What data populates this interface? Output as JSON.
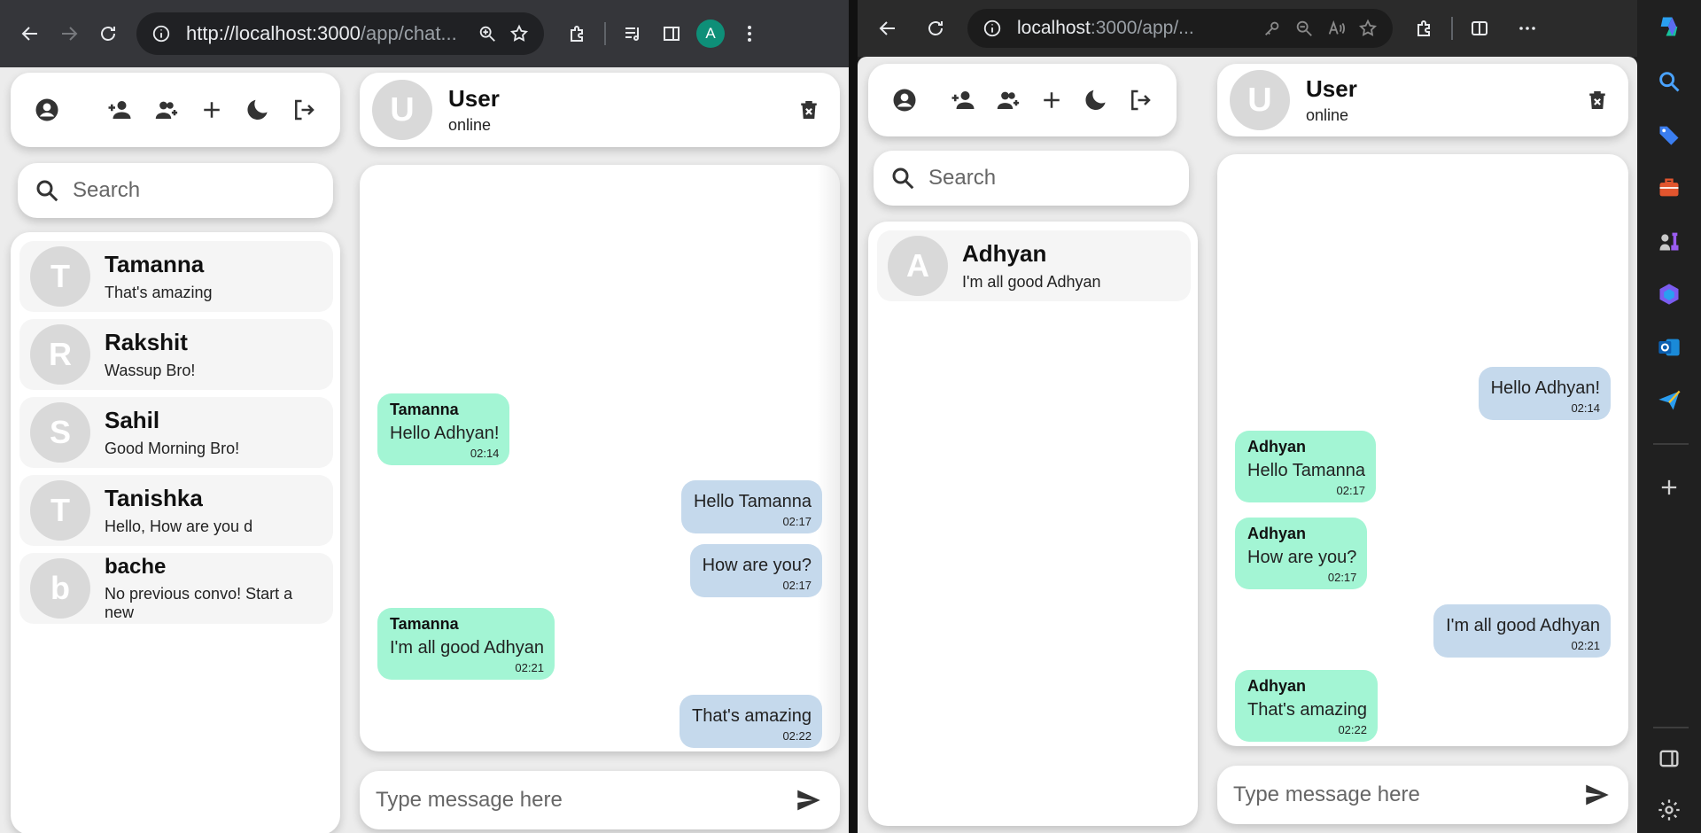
{
  "left_browser": {
    "url_host": "http://localhost:3000",
    "url_path": "/app/chat...",
    "avatar_letter": "A"
  },
  "right_browser": {
    "url_host": "localhost",
    "url_path": ":3000/app/..."
  },
  "app": {
    "search_placeholder": "Search",
    "composer_placeholder": "Type message here",
    "chat_header": {
      "avatar_letter": "U",
      "name": "User",
      "status": "online"
    }
  },
  "left_app": {
    "contacts": [
      {
        "letter": "T",
        "name": "Tamanna",
        "last_message": "That's amazing"
      },
      {
        "letter": "R",
        "name": "Rakshit",
        "last_message": "Wassup Bro!"
      },
      {
        "letter": "S",
        "name": "Sahil",
        "last_message": "Good Morning Bro!"
      },
      {
        "letter": "T",
        "name": "Tanishka",
        "last_message": "Hello, How are you d"
      },
      {
        "letter": "b",
        "name": "bache",
        "last_message": "No previous convo! Start a new"
      }
    ],
    "messages": [
      {
        "direction": "received",
        "sender": "Tamanna",
        "text": "Hello Adhyan!",
        "time": "02:14"
      },
      {
        "direction": "sent",
        "text": "Hello Tamanna",
        "time": "02:17"
      },
      {
        "direction": "sent",
        "text": "How are you?",
        "time": "02:17"
      },
      {
        "direction": "received",
        "sender": "Tamanna",
        "text": "I'm all good Adhyan",
        "time": "02:21"
      },
      {
        "direction": "sent",
        "text": "That's amazing",
        "time": "02:22"
      }
    ]
  },
  "right_app": {
    "contacts": [
      {
        "letter": "A",
        "name": "Adhyan",
        "last_message": "I'm all good Adhyan"
      }
    ],
    "messages": [
      {
        "direction": "sent",
        "text": "Hello Adhyan!",
        "time": "02:14"
      },
      {
        "direction": "received",
        "sender": "Adhyan",
        "text": "Hello Tamanna",
        "time": "02:17"
      },
      {
        "direction": "received",
        "sender": "Adhyan",
        "text": "How are you?",
        "time": "02:17"
      },
      {
        "direction": "sent",
        "text": "I'm all good Adhyan",
        "time": "02:21"
      },
      {
        "direction": "received",
        "sender": "Adhyan",
        "text": "That's amazing",
        "time": "02:22"
      }
    ]
  },
  "colors": {
    "received_bubble": "#a3f5d4",
    "sent_bubble": "#c5d9ec",
    "avatar_bg": "#d9d9d9",
    "app_bg": "#ececec"
  }
}
